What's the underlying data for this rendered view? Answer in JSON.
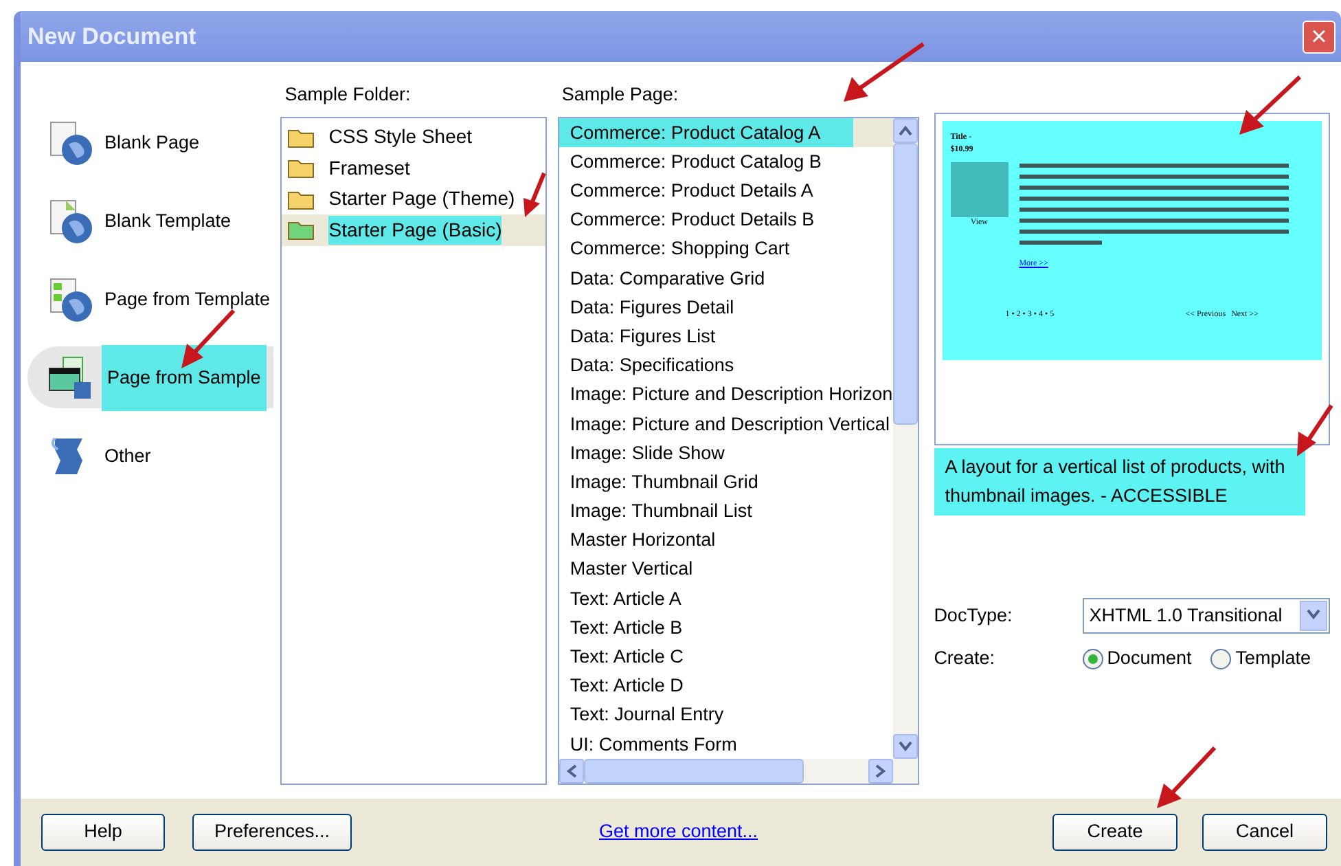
{
  "window": {
    "title": "New Document",
    "close": "×"
  },
  "categories": [
    {
      "label": "Blank Page",
      "kind": "blank",
      "selected": false
    },
    {
      "label": "Blank Template",
      "kind": "template",
      "selected": false
    },
    {
      "label": "Page from Template",
      "kind": "from-template",
      "selected": false
    },
    {
      "label": "Page from Sample",
      "kind": "sample",
      "selected": true
    },
    {
      "label": "Other",
      "kind": "other",
      "selected": false
    }
  ],
  "sample_folder": {
    "label": "Sample Folder:",
    "items": [
      {
        "label": "CSS Style Sheet",
        "selected": false
      },
      {
        "label": "Frameset",
        "selected": false
      },
      {
        "label": "Starter Page (Theme)",
        "selected": false
      },
      {
        "label": "Starter Page (Basic)",
        "selected": true
      }
    ]
  },
  "sample_page": {
    "label": "Sample Page:",
    "items": [
      {
        "label": "Commerce: Product Catalog A",
        "selected": true
      },
      {
        "label": "Commerce: Product Catalog B",
        "selected": false
      },
      {
        "label": "Commerce: Product Details A",
        "selected": false
      },
      {
        "label": "Commerce: Product Details B",
        "selected": false
      },
      {
        "label": "Commerce: Shopping Cart",
        "selected": false
      },
      {
        "label": "Data: Comparative Grid",
        "selected": false
      },
      {
        "label": "Data: Figures Detail",
        "selected": false
      },
      {
        "label": "Data: Figures List",
        "selected": false
      },
      {
        "label": "Data: Specifications",
        "selected": false
      },
      {
        "label": "Image: Picture and Description Horizon",
        "selected": false
      },
      {
        "label": "Image: Picture and Description Vertical",
        "selected": false
      },
      {
        "label": "Image: Slide Show",
        "selected": false
      },
      {
        "label": "Image: Thumbnail Grid",
        "selected": false
      },
      {
        "label": "Image: Thumbnail List",
        "selected": false
      },
      {
        "label": "Master Horizontal",
        "selected": false
      },
      {
        "label": "Master Vertical",
        "selected": false
      },
      {
        "label": "Text: Article A",
        "selected": false
      },
      {
        "label": "Text: Article B",
        "selected": false
      },
      {
        "label": "Text: Article C",
        "selected": false
      },
      {
        "label": "Text: Article D",
        "selected": false
      },
      {
        "label": "Text: Journal Entry",
        "selected": false
      },
      {
        "label": "UI: Comments Form",
        "selected": false
      }
    ]
  },
  "preview": {
    "title": "Title -",
    "price": "$10.99",
    "view_link": "View",
    "more_link": "More >>",
    "pages": "1 • 2 • 3 • 4 • 5",
    "prev_link": "<< Previous",
    "next_link": "Next >>"
  },
  "description": "A layout for a vertical list of products, with thumbnail images. - ACCESSIBLE",
  "doctype": {
    "label": "DocType:",
    "value": "XHTML 1.0 Transitional"
  },
  "create": {
    "label": "Create:",
    "options": [
      {
        "label": "Document",
        "selected": true
      },
      {
        "label": "Template",
        "selected": false
      }
    ]
  },
  "footer": {
    "buttons_left": [
      "Help",
      "Preferences..."
    ],
    "link": "Get more content...",
    "buttons_right": [
      "Create",
      "Cancel"
    ]
  }
}
